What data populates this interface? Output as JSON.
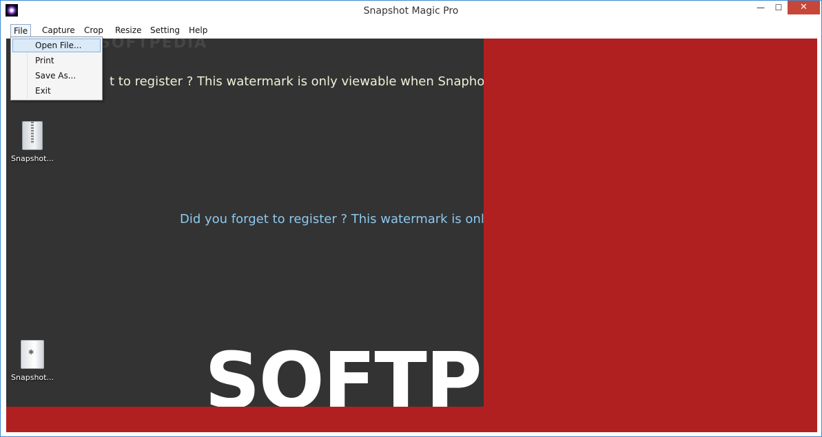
{
  "window": {
    "title": "Snapshot Magic Pro",
    "minimize_glyph": "—",
    "maximize_glyph": "☐",
    "close_glyph": "✕"
  },
  "menubar": {
    "items": [
      {
        "label": "File"
      },
      {
        "label": "Capture"
      },
      {
        "label": "Crop"
      },
      {
        "label": "Resize"
      },
      {
        "label": "Setting"
      },
      {
        "label": "Help"
      }
    ]
  },
  "file_menu": {
    "items": [
      {
        "label": "Open File..."
      },
      {
        "label": "Print"
      },
      {
        "label": "Save As..."
      },
      {
        "label": "Exit"
      }
    ]
  },
  "canvas": {
    "watermark_top": "t to register ? This watermark is only viewable when Snaphot Mag",
    "watermark_middle": "Did you forget to register ? This watermark is only v",
    "logo_text": "SOFTP",
    "ghost_text": "SOFTPEDIA"
  },
  "desktop_icons": [
    {
      "label": "Snapshot...",
      "icon": "zip-folder-icon"
    },
    {
      "label": "Snapshot...",
      "icon": "folder-icon"
    }
  ],
  "colors": {
    "background_red": "#b12020",
    "canvas_dark": "#333333",
    "watermark_blue": "#8ec9ef",
    "menu_highlight": "#dceaf8"
  }
}
